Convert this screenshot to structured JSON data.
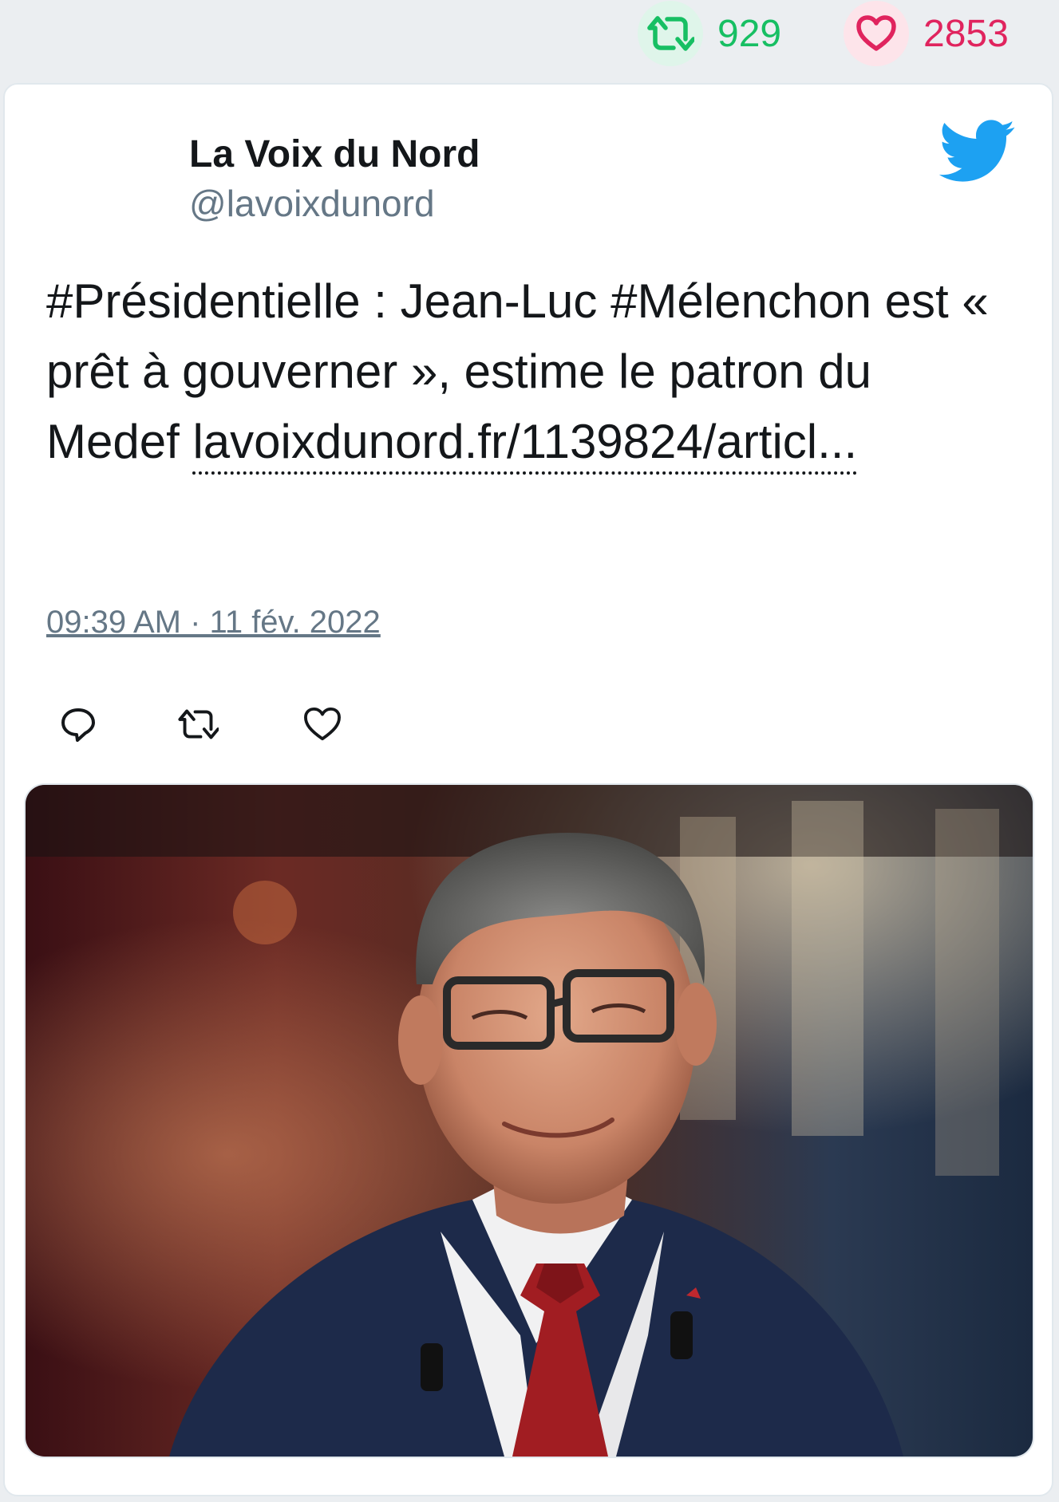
{
  "stats": {
    "retweet_icon": "retweet-icon",
    "retweet_count": "929",
    "like_icon": "heart-icon",
    "like_count": "2853",
    "retweet_color": "#17bf63",
    "like_color": "#e0245e"
  },
  "tweet": {
    "author_name": "La Voix du Nord",
    "author_handle": "@lavoixdunord",
    "text": "#Présidentielle : Jean-Luc #Mélenchon est « prêt à gouverner », estime le patron du Medef",
    "link_text": "lavoixdunord.fr/1139824/articl...",
    "timestamp": "09:39 AM · 11 fév. 2022",
    "brand_icon": "twitter-bird-icon",
    "brand_color": "#1da1f2"
  },
  "actions": [
    {
      "icon": "reply-icon"
    },
    {
      "icon": "retweet-icon"
    },
    {
      "icon": "like-icon"
    }
  ],
  "media": {
    "kind": "photo",
    "subject": "smiling man with glasses in suit and red tie"
  }
}
